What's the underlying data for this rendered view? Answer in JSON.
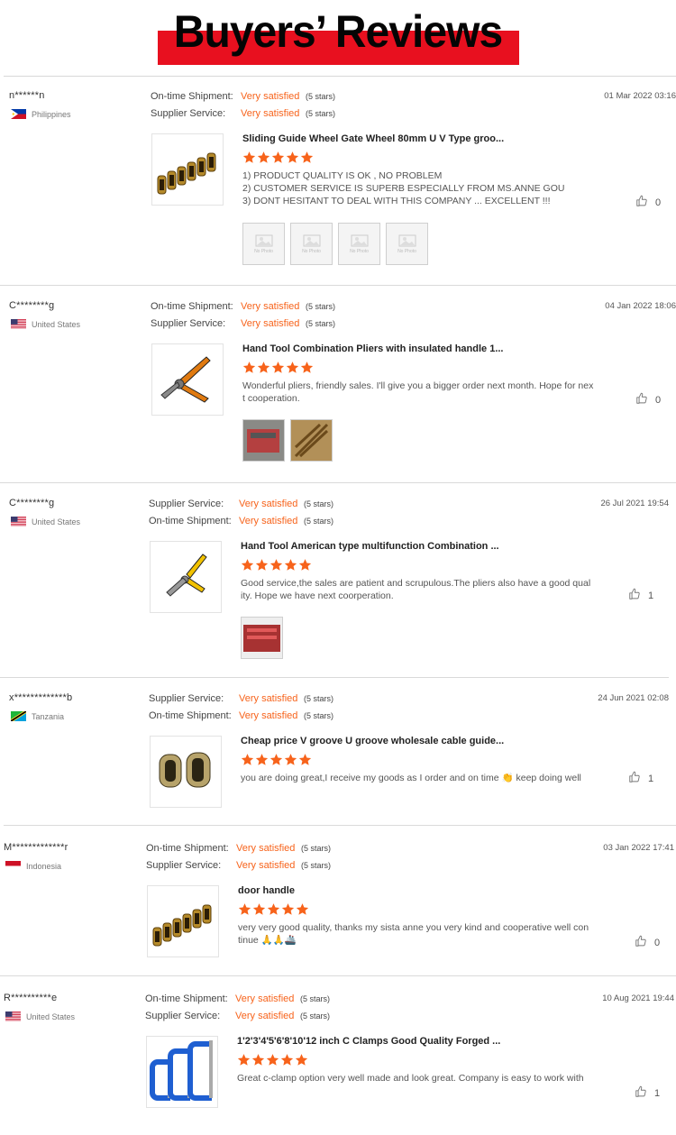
{
  "banner": {
    "title": "Buyers’ Reviews",
    "bar_color": "#e8101f"
  },
  "colors": {
    "accent": "#f7631b",
    "text": "#333333",
    "muted": "#777777"
  },
  "reviews": [
    {
      "buyer": "n******n",
      "country": "Philippines",
      "flag": "philippines-flag",
      "ratings": [
        {
          "label": "On-time Shipment:",
          "value": "Very satisfied",
          "stars": "(5 stars)"
        },
        {
          "label": "Supplier Service:",
          "value": "Very satisfied",
          "stars": "(5 stars)"
        }
      ],
      "date": "01 Mar 2022 03:16",
      "product_title": "Sliding Guide Wheel Gate Wheel 80mm U V Type groo...",
      "product_rating": 5,
      "comment": "1) PRODUCT QUALITY IS OK , NO PROBLEM\n2) CUSTOMER SERVICE IS SUPERB ESPECIALLY FROM MS.ANNE GOU\n3) DONT HESITANT TO DEAL WITH THIS COMPANY ... EXCELLENT !!!",
      "likes": "0",
      "photos": [
        "No Photo",
        "No Photo",
        "No Photo",
        "No Photo"
      ]
    },
    {
      "buyer": "C********g",
      "country": "United States",
      "flag": "us-flag",
      "ratings": [
        {
          "label": "On-time Shipment:",
          "value": "Very satisfied",
          "stars": "(5 stars)"
        },
        {
          "label": "Supplier Service:",
          "value": "Very satisfied",
          "stars": "(5 stars)"
        }
      ],
      "date": "04 Jan 2022 18:06",
      "product_title": "Hand Tool Combination Pliers with insulated handle 1...",
      "product_rating": 5,
      "comment": "Wonderful pliers, friendly sales. I'll give you a bigger order next month. Hope for next cooperation.",
      "likes": "0",
      "photos": [
        "photo",
        "photo"
      ]
    },
    {
      "buyer": "C********g",
      "country": "United States",
      "flag": "us-flag",
      "ratings": [
        {
          "label": "Supplier Service:",
          "value": "Very satisfied",
          "stars": "(5 stars)"
        },
        {
          "label": "On-time Shipment:",
          "value": "Very satisfied",
          "stars": "(5 stars)"
        }
      ],
      "date": "26 Jul 2021 19:54",
      "product_title": "Hand Tool American type multifunction Combination ...",
      "product_rating": 5,
      "comment": "Good service,the sales are patient and scrupulous.The pliers also have a good quality. Hope we have next coorperation.",
      "likes": "1",
      "photos": [
        "photo"
      ]
    },
    {
      "buyer": "x*************b",
      "country": "Tanzania",
      "flag": "tanzania-flag",
      "ratings": [
        {
          "label": "Supplier Service:",
          "value": "Very satisfied",
          "stars": "(5 stars)"
        },
        {
          "label": "On-time Shipment:",
          "value": "Very satisfied",
          "stars": "(5 stars)"
        }
      ],
      "date": "24 Jun 2021 02:08",
      "product_title": "Cheap price V groove U groove wholesale cable guide...",
      "product_rating": 5,
      "comment": "you are doing great,I receive my goods as I order and on time 👏 keep doing well",
      "likes": "1",
      "photos": []
    },
    {
      "buyer": "M*************r",
      "country": "Indonesia",
      "flag": "indonesia-flag",
      "ratings": [
        {
          "label": "On-time Shipment:",
          "value": "Very satisfied",
          "stars": "(5 stars)"
        },
        {
          "label": "Supplier Service:",
          "value": "Very satisfied",
          "stars": "(5 stars)"
        }
      ],
      "date": "03 Jan 2022 17:41",
      "product_title": "door handle",
      "product_rating": 5,
      "comment": "very very good quality, thanks my sista anne you very kind and cooperative well continue 🙏🙏🚢",
      "likes": "0",
      "photos": []
    },
    {
      "buyer": "R**********e",
      "country": "United States",
      "flag": "us-flag",
      "ratings": [
        {
          "label": "On-time Shipment:",
          "value": "Very satisfied",
          "stars": "(5 stars)"
        },
        {
          "label": "Supplier Service:",
          "value": "Very satisfied",
          "stars": "(5 stars)"
        }
      ],
      "date": "10 Aug 2021 19:44",
      "product_title": "1'2'3'4'5'6'8'10'12 inch C Clamps Good Quality Forged ...",
      "product_rating": 5,
      "comment": "Great c-clamp option very well made and look great.  Company is easy to work with",
      "likes": "1",
      "photos": []
    }
  ]
}
